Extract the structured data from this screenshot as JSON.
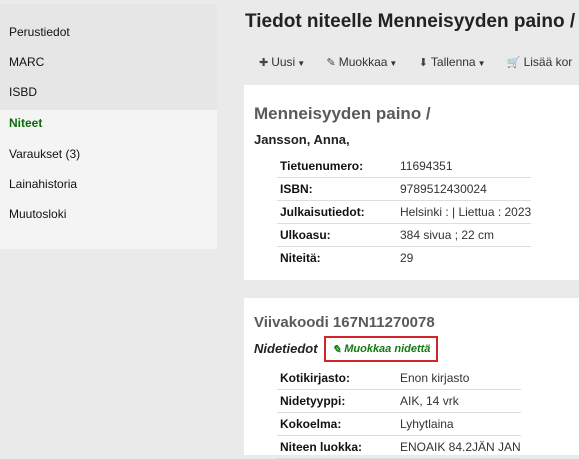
{
  "sidebar": {
    "items": [
      {
        "label": "Perustiedot"
      },
      {
        "label": "MARC"
      },
      {
        "label": "ISBD"
      },
      {
        "label": "Niteet"
      },
      {
        "label": "Varaukset (3)"
      },
      {
        "label": "Lainahistoria"
      },
      {
        "label": "Muutosloki"
      }
    ]
  },
  "header": {
    "title": "Tiedot niteelle Menneisyyden paino /"
  },
  "toolbar": {
    "new_label": "Uusi",
    "edit_label": "Muokkaa",
    "save_label": "Tallenna",
    "add_label": "Lisää kor"
  },
  "record": {
    "title": "Menneisyyden paino /",
    "author": "Jansson, Anna,",
    "fields": [
      {
        "label": "Tietuenumero:",
        "value": "11694351"
      },
      {
        "label": "ISBN:",
        "value": "9789512430024"
      },
      {
        "label": "Julkaisutiedot:",
        "value": "Helsinki : | Liettua : 2023"
      },
      {
        "label": "Ulkoasu:",
        "value": "384 sivua ; 22 cm"
      },
      {
        "label": "Niteitä:",
        "value": "29"
      }
    ]
  },
  "item": {
    "title": "Viivakoodi 167N11270078",
    "section_label": "Nidetiedot",
    "edit_link": "Muokkaa nidettä",
    "fields": [
      {
        "label": "Kotikirjasto:",
        "value": "Enon kirjasto"
      },
      {
        "label": "Nidetyyppi:",
        "value": "AIK, 14 vrk"
      },
      {
        "label": "Kokoelma:",
        "value": "Lyhytlaina"
      },
      {
        "label": "Niteen luokka:",
        "value": "ENOAIK 84.2JÄN JAN"
      }
    ]
  },
  "colors": {
    "active_nav": "#0a6b0a",
    "highlight_border": "#d0262a",
    "link": "#137a13"
  }
}
